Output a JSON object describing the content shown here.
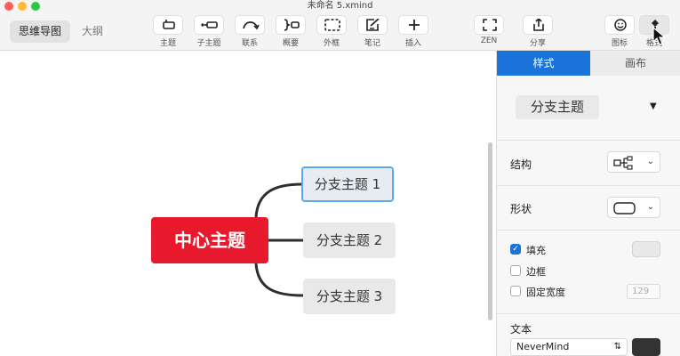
{
  "window": {
    "title": "未命名 5.xmind"
  },
  "view_tabs": {
    "mindmap": "思维导图",
    "outline": "大纲"
  },
  "toolbar": {
    "topic": "主题",
    "subtopic": "子主题",
    "relationship": "联系",
    "summary": "概要",
    "boundary": "外框",
    "note": "笔记",
    "insert": "插入",
    "zen": "ZEN",
    "share": "分享",
    "icon": "图标",
    "format": "格式"
  },
  "mindmap": {
    "central": "中心主题",
    "branches": [
      "分支主题 1",
      "分支主题 2",
      "分支主题 3"
    ],
    "central_color": "#e8192c",
    "selected_branch": 1
  },
  "panel": {
    "tabs": {
      "style": "样式",
      "canvas": "画布"
    },
    "style_name": "分支主题",
    "structure_label": "结构",
    "shape_label": "形状",
    "fill_label": "填充",
    "fill_checked": true,
    "border_label": "边框",
    "border_checked": false,
    "fixed_width_label": "固定宽度",
    "fixed_width_checked": false,
    "fixed_width_value": "129",
    "text_label": "文本",
    "font_name": "NeverMind",
    "accent": "#1a73d9"
  }
}
